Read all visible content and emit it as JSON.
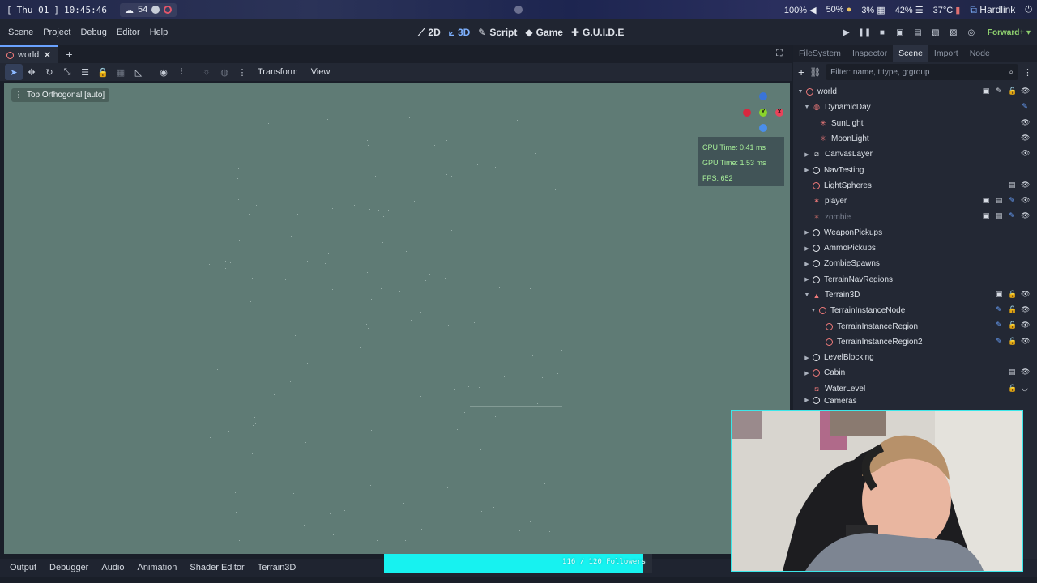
{
  "os_bar": {
    "date": "Thu 01",
    "time": "10:45:46",
    "weather": "54",
    "volume": "100%",
    "mic": "50%",
    "cpu": "3%",
    "memory": "42%",
    "temperature": "37°C",
    "network": "Hardlink"
  },
  "menu": {
    "items": [
      "Scene",
      "Project",
      "Debug",
      "Editor",
      "Help"
    ]
  },
  "workspaces": [
    "2D",
    "3D",
    "Script",
    "Game",
    "G.U.I.D.E"
  ],
  "renderer": "Forward+",
  "scene_tab": {
    "name": "world"
  },
  "viewport_toolbar": {
    "transform": "Transform",
    "view": "View"
  },
  "viewport": {
    "label": "Top Orthogonal [auto]",
    "stats": {
      "cpu": "CPU Time: 0.41 ms",
      "gpu": "GPU Time: 1.53 ms",
      "fps": "FPS: 652"
    },
    "gizmo": {
      "y": "Y",
      "x": "X"
    }
  },
  "dock": {
    "tabs": [
      "FileSystem",
      "Inspector",
      "Scene",
      "Import",
      "Node"
    ],
    "filter_placeholder": "Filter: name, t:type, g:group",
    "nodes": [
      {
        "name": "world"
      },
      {
        "name": "DynamicDay"
      },
      {
        "name": "SunLight"
      },
      {
        "name": "MoonLight"
      },
      {
        "name": "CanvasLayer"
      },
      {
        "name": "NavTesting"
      },
      {
        "name": "LightSpheres"
      },
      {
        "name": "player"
      },
      {
        "name": "zombie"
      },
      {
        "name": "WeaponPickups"
      },
      {
        "name": "AmmoPickups"
      },
      {
        "name": "ZombieSpawns"
      },
      {
        "name": "TerrainNavRegions"
      },
      {
        "name": "Terrain3D"
      },
      {
        "name": "TerrainInstanceNode"
      },
      {
        "name": "TerrainInstanceRegion"
      },
      {
        "name": "TerrainInstanceRegion2"
      },
      {
        "name": "LevelBlocking"
      },
      {
        "name": "Cabin"
      },
      {
        "name": "WaterLevel"
      },
      {
        "name": "Cameras"
      }
    ]
  },
  "bottom_panels": [
    "Output",
    "Debugger",
    "Audio",
    "Animation",
    "Shader Editor",
    "Terrain3D"
  ],
  "followers": {
    "text": "116 / 120 Followers",
    "progress": 0.9667
  },
  "colors": {
    "viewport": "#5f7b75",
    "accent": "#6aa2ff",
    "follower_bar": "#17f2f0",
    "webcam_border": "#3ce7ea"
  }
}
